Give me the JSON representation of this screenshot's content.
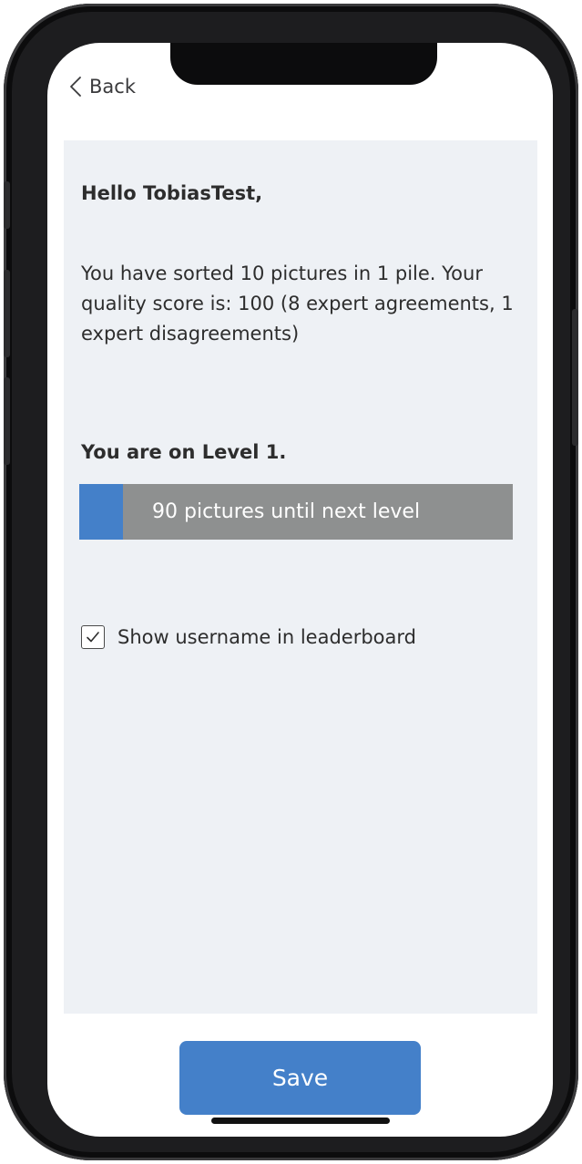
{
  "nav": {
    "back_label": "Back"
  },
  "greeting": "Hello TobiasTest,",
  "summary": "You have sorted 10 pictures in 1 pile. Your quality score is: 100 (8 expert agreements, 1 expert disagreements)",
  "level": {
    "title": "You are on Level 1.",
    "progress_fraction": 0.1,
    "progress_text": "90 pictures until next level"
  },
  "leaderboard_option": {
    "label": "Show username in leaderboard",
    "checked": true
  },
  "save_label": "Save",
  "colors": {
    "accent": "#4480c9",
    "progress_track": "#8e9090",
    "card_background": "#eef1f5"
  },
  "icons": [
    "chevron-left-icon",
    "checkmark-icon"
  ]
}
